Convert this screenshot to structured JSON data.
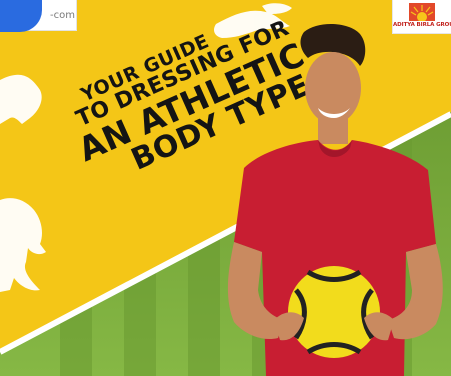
{
  "site_logo": {
    "text": "-com"
  },
  "brand": {
    "name": "ADITYA BIRLA GROUP"
  },
  "headline": {
    "line1": "YOUR GUIDE",
    "line2": "TO DRESSING FOR",
    "line3": "AN ATHLETIC",
    "line4": "BODY TYPE"
  },
  "colors": {
    "background_yellow": "#f4c617",
    "field_green": "#7cae3c",
    "shirt_red": "#c81e32",
    "ball_yellow": "#f2dc1c",
    "logo_blue": "#2a6be0"
  }
}
